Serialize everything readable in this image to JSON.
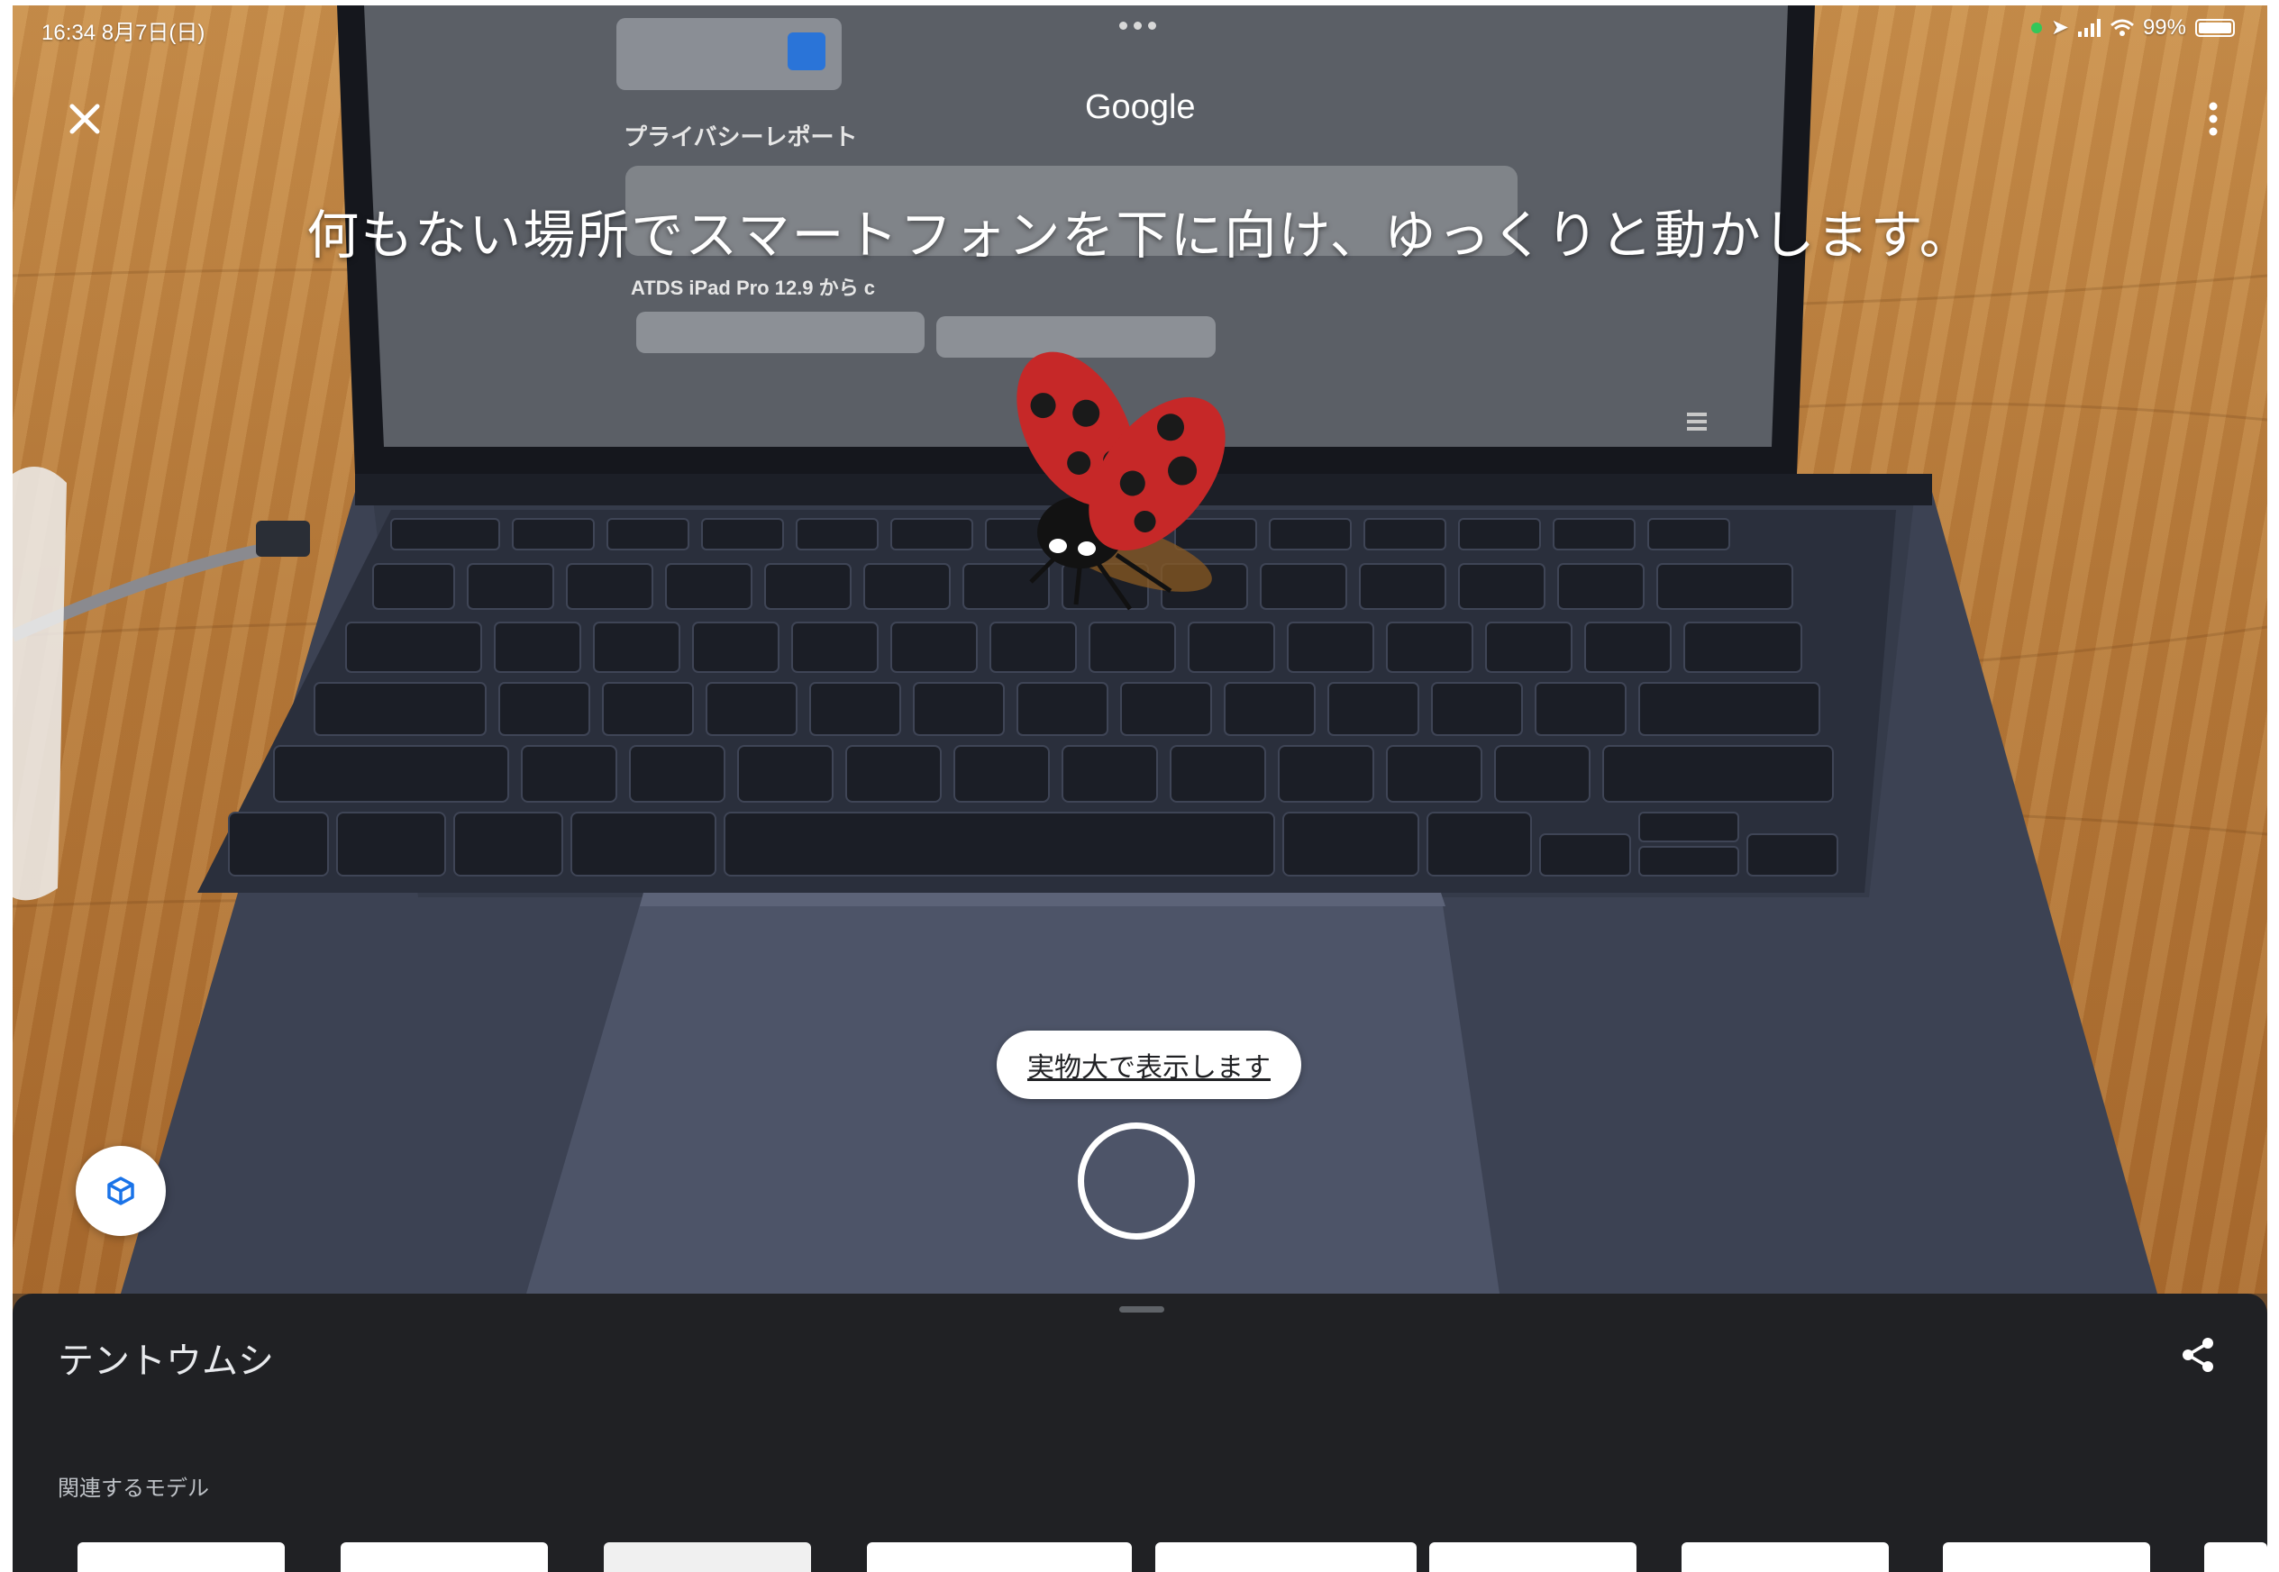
{
  "status_bar": {
    "time_date": "16:34  8月7日(日)",
    "battery": "99%"
  },
  "screen_text": {
    "google": "Google",
    "privacy_report": "プライバシーレポート",
    "device_line": "ATDS iPad Pro 12.9 から c"
  },
  "ar": {
    "instruction": "何もない場所でスマートフォンを下に向け、ゆっくりと動かします。",
    "view_actual_size": "実物大で表示します"
  },
  "sheet": {
    "title": "テントウムシ",
    "related_label": "関連するモデル",
    "related_count": 9
  },
  "icons": {
    "close": "close-icon",
    "more": "more-vert-icon",
    "share": "share-icon",
    "model": "cube-icon",
    "shutter": "shutter-icon"
  },
  "colors": {
    "sheet_bg": "#202124",
    "model_icon": "#1a73e8",
    "ladybug_red": "#c62828"
  }
}
